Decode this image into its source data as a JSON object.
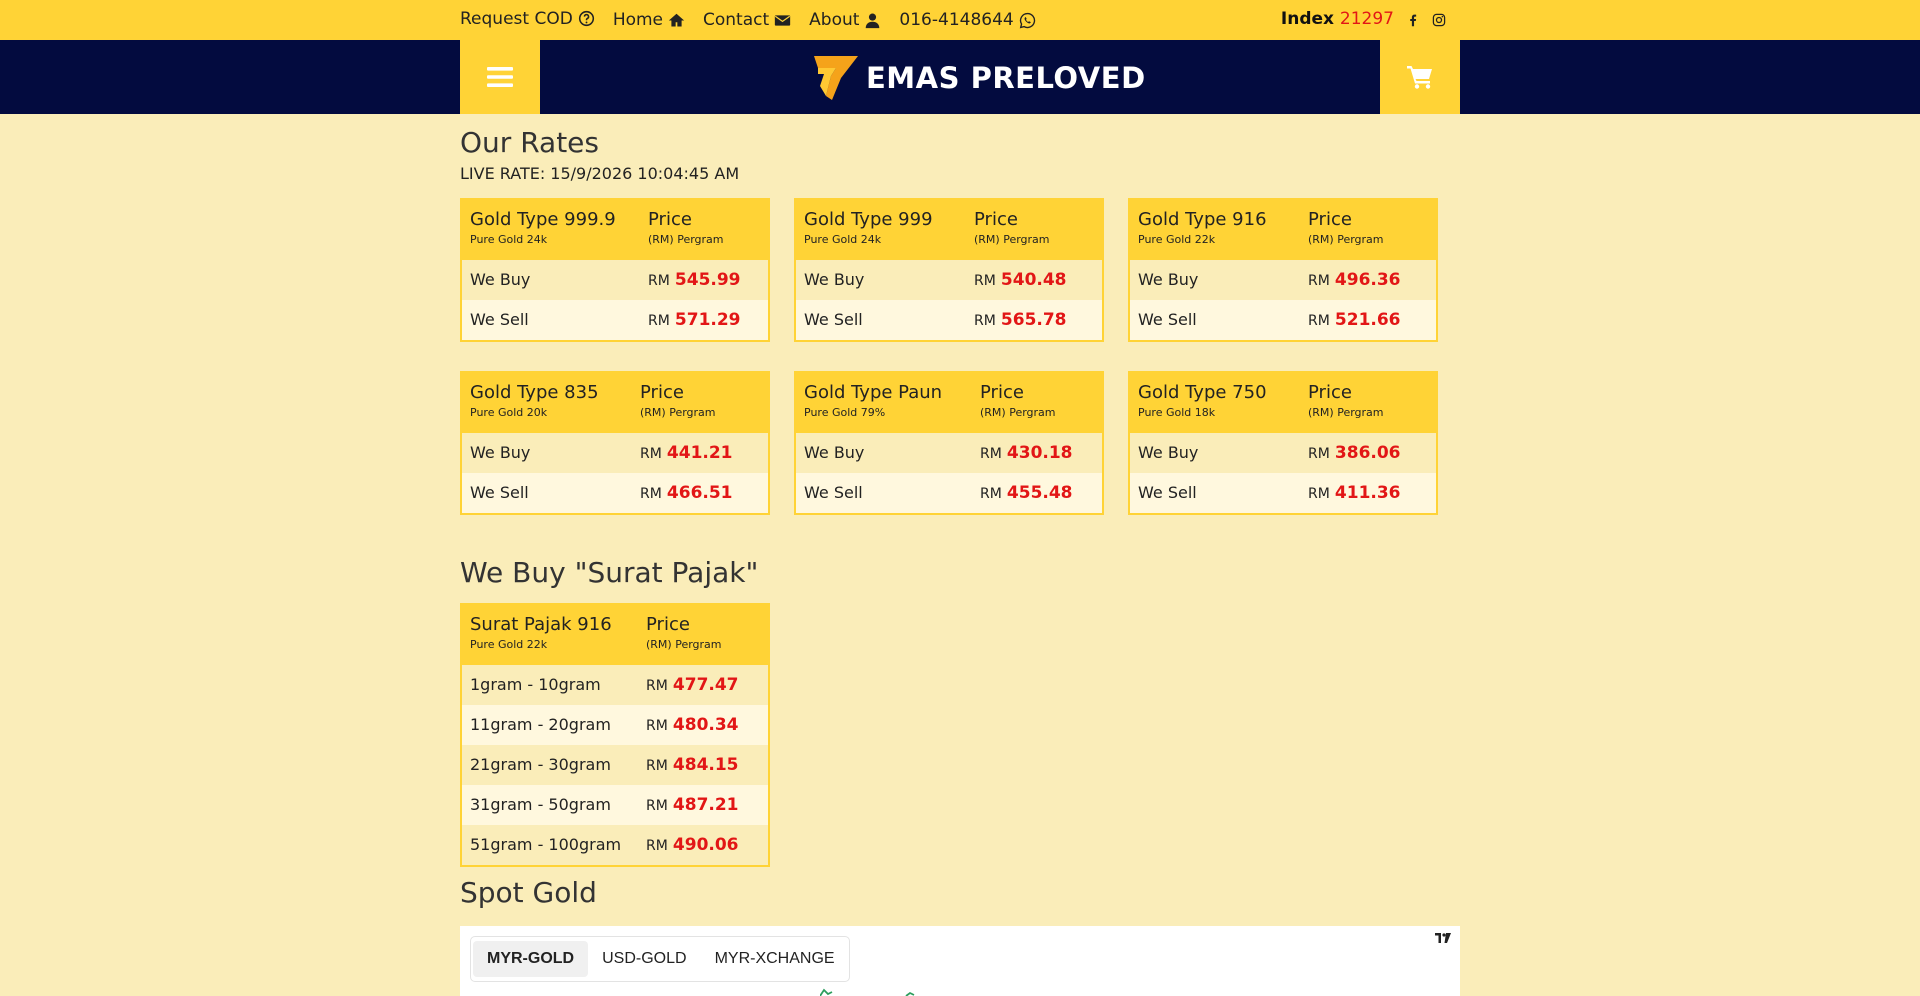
{
  "topbar": {
    "request_cod": "Request COD",
    "home": "Home",
    "contact": "Contact",
    "about": "About",
    "phone": "016-4148644",
    "index_label": "Index",
    "index_value": "21297"
  },
  "header": {
    "logo_text": "EMAS PRELOVED"
  },
  "rates": {
    "title": "Our Rates",
    "live_rate": "LIVE RATE: 15/9/2026 10:04:45 AM",
    "price_label": "Price",
    "price_unit": "(RM) Pergram",
    "currency": "RM",
    "buy_label": "We Buy",
    "sell_label": "We Sell",
    "tables": [
      {
        "type": "Gold Type 999.9",
        "sub": "Pure Gold 24k",
        "buy": "545.99",
        "sell": "571.29"
      },
      {
        "type": "Gold Type 999",
        "sub": "Pure Gold 24k",
        "buy": "540.48",
        "sell": "565.78"
      },
      {
        "type": "Gold Type 916",
        "sub": "Pure Gold 22k",
        "buy": "496.36",
        "sell": "521.66"
      },
      {
        "type": "Gold Type 835",
        "sub": "Pure Gold 20k",
        "buy": "441.21",
        "sell": "466.51"
      },
      {
        "type": "Gold Type Paun",
        "sub": "Pure Gold 79%",
        "buy": "430.18",
        "sell": "455.48"
      },
      {
        "type": "Gold Type 750",
        "sub": "Pure Gold 18k",
        "buy": "386.06",
        "sell": "411.36"
      }
    ]
  },
  "surat": {
    "title": "We Buy \"Surat Pajak\"",
    "type": "Surat Pajak 916",
    "sub": "Pure Gold 22k",
    "rows": [
      {
        "range": "1gram - 10gram",
        "price": "477.47"
      },
      {
        "range": "11gram - 20gram",
        "price": "480.34"
      },
      {
        "range": "21gram - 30gram",
        "price": "484.15"
      },
      {
        "range": "31gram - 50gram",
        "price": "487.21"
      },
      {
        "range": "51gram - 100gram",
        "price": "490.06"
      }
    ]
  },
  "spot": {
    "title": "Spot Gold",
    "tabs": [
      "MYR-GOLD",
      "USD-GOLD",
      "MYR-XCHANGE"
    ],
    "active_tab": "MYR-GOLD"
  },
  "colors": {
    "accent": "#ffd336",
    "navy": "#030b3f",
    "price_red": "#e21616",
    "background": "#faedb9"
  },
  "icons": {
    "request_cod": "question-circle-icon",
    "home": "home-icon",
    "contact": "envelope-icon",
    "about": "user-icon",
    "phone": "whatsapp-icon",
    "social": [
      "facebook-icon",
      "instagram-icon"
    ],
    "menu": "hamburger-menu-icon",
    "cart": "shopping-cart-icon"
  }
}
